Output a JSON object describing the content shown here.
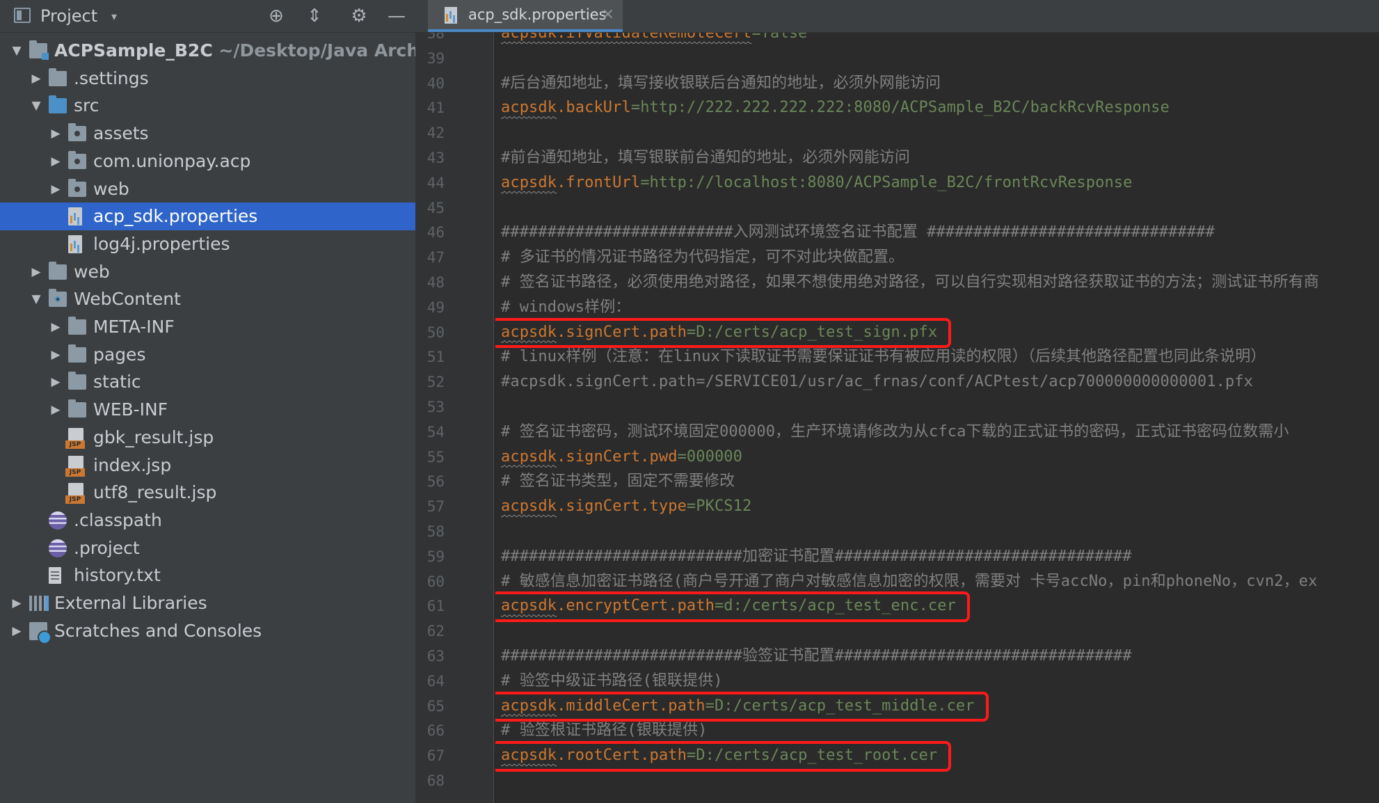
{
  "project_panel": {
    "title": "Project",
    "dropdown_glyph": "▾",
    "tools": [
      "crosshair-icon",
      "collapse-icon",
      "gear-icon",
      "minimize-icon"
    ],
    "tree": [
      {
        "label": "ACPSample_B2C",
        "hint": "~/Desktop/Java Archi",
        "icon": "module-icon",
        "arrow": "▼",
        "depth": 0,
        "bold": true
      },
      {
        "label": ".settings",
        "icon": "folder-icon",
        "arrow": "▶",
        "depth": 1
      },
      {
        "label": "src",
        "icon": "source-folder-icon",
        "arrow": "▼",
        "depth": 1
      },
      {
        "label": "assets",
        "icon": "package-icon",
        "arrow": "▶",
        "depth": 2
      },
      {
        "label": "com.unionpay.acp",
        "icon": "package-icon",
        "arrow": "▶",
        "depth": 2
      },
      {
        "label": "web",
        "icon": "package-icon",
        "arrow": "▶",
        "depth": 2
      },
      {
        "label": "acp_sdk.properties",
        "icon": "properties-file-icon",
        "arrow": "",
        "depth": 2,
        "selected": true
      },
      {
        "label": "log4j.properties",
        "icon": "properties-file-icon",
        "arrow": "",
        "depth": 2
      },
      {
        "label": "web",
        "icon": "folder-icon",
        "arrow": "▶",
        "depth": 1
      },
      {
        "label": "WebContent",
        "icon": "web-folder-icon",
        "arrow": "▼",
        "depth": 1
      },
      {
        "label": "META-INF",
        "icon": "folder-icon",
        "arrow": "▶",
        "depth": 2
      },
      {
        "label": "pages",
        "icon": "folder-icon",
        "arrow": "▶",
        "depth": 2
      },
      {
        "label": "static",
        "icon": "folder-icon",
        "arrow": "▶",
        "depth": 2
      },
      {
        "label": "WEB-INF",
        "icon": "folder-icon",
        "arrow": "▶",
        "depth": 2
      },
      {
        "label": "gbk_result.jsp",
        "icon": "jsp-file-icon",
        "arrow": "",
        "depth": 2
      },
      {
        "label": "index.jsp",
        "icon": "jsp-file-icon",
        "arrow": "",
        "depth": 2
      },
      {
        "label": "utf8_result.jsp",
        "icon": "jsp-file-icon",
        "arrow": "",
        "depth": 2
      },
      {
        "label": ".classpath",
        "icon": "eclipse-file-icon",
        "arrow": "",
        "depth": 1
      },
      {
        "label": ".project",
        "icon": "eclipse-file-icon",
        "arrow": "",
        "depth": 1
      },
      {
        "label": "history.txt",
        "icon": "text-file-icon",
        "arrow": "",
        "depth": 1
      },
      {
        "label": "External Libraries",
        "icon": "libraries-icon",
        "arrow": "▶",
        "depth": 0
      },
      {
        "label": "Scratches and Consoles",
        "icon": "scratches-icon",
        "arrow": "▶",
        "depth": 0
      }
    ]
  },
  "editor": {
    "tab": {
      "label": "acp_sdk.properties",
      "close": "×"
    },
    "lines": [
      {
        "n": "38",
        "parts": [
          {
            "t": "acpsdk.ifValidateRemoteCert",
            "s": "k"
          },
          {
            "t": "=false",
            "s": "v"
          }
        ]
      },
      {
        "n": "39",
        "parts": []
      },
      {
        "n": "40",
        "parts": [
          {
            "t": "#后台通知地址，填写接收银联后台通知的地址，必须外网能访问",
            "s": "c"
          }
        ]
      },
      {
        "n": "41",
        "parts": [
          {
            "t": "acpsdk",
            "s": "k"
          },
          {
            "t": ".backUrl",
            "s": "k2"
          },
          {
            "t": "=http://222.222.222.222:8080/ACPSample_B2C/backRcvResponse",
            "s": "v"
          }
        ]
      },
      {
        "n": "42",
        "parts": []
      },
      {
        "n": "43",
        "parts": [
          {
            "t": "#前台通知地址，填写银联前台通知的地址，必须外网能访问",
            "s": "c"
          }
        ]
      },
      {
        "n": "44",
        "parts": [
          {
            "t": "acpsdk",
            "s": "k"
          },
          {
            "t": ".frontUrl",
            "s": "k2"
          },
          {
            "t": "=http://localhost:8080/ACPSample_B2C/frontRcvResponse",
            "s": "v"
          }
        ]
      },
      {
        "n": "45",
        "parts": []
      },
      {
        "n": "46",
        "parts": [
          {
            "t": "#########################入网测试环境签名证书配置 ###############################",
            "s": "c"
          }
        ]
      },
      {
        "n": "47",
        "parts": [
          {
            "t": "# 多证书的情况证书路径为代码指定，可不对此块做配置。",
            "s": "c"
          }
        ]
      },
      {
        "n": "48",
        "parts": [
          {
            "t": "# 签名证书路径，必须使用绝对路径，如果不想使用绝对路径，可以自行实现相对路径获取证书的方法；测试证书所有商",
            "s": "c"
          }
        ]
      },
      {
        "n": "49",
        "parts": [
          {
            "t": "# windows样例：",
            "s": "c"
          }
        ]
      },
      {
        "n": "50",
        "parts": [
          {
            "t": "acpsdk",
            "s": "k"
          },
          {
            "t": ".signCert.path",
            "s": "k2"
          },
          {
            "t": "=D:/certs/acp_test_sign.pfx",
            "s": "v"
          }
        ]
      },
      {
        "n": "51",
        "parts": [
          {
            "t": "# linux样例（注意：在linux下读取证书需要保证证书有被应用读的权限）（后续其他路径配置也同此条说明）",
            "s": "c"
          }
        ]
      },
      {
        "n": "52",
        "parts": [
          {
            "t": "#acpsdk.signCert.path=/SERVICE01/usr/ac_frnas/conf/ACPtest/acp700000000000001.pfx",
            "s": "c"
          }
        ]
      },
      {
        "n": "53",
        "parts": []
      },
      {
        "n": "54",
        "parts": [
          {
            "t": "# 签名证书密码，测试环境固定000000，生产环境请修改为从cfca下载的正式证书的密码，正式证书密码位数需小",
            "s": "c"
          }
        ]
      },
      {
        "n": "55",
        "parts": [
          {
            "t": "acpsdk",
            "s": "k"
          },
          {
            "t": ".signCert.pwd",
            "s": "k2"
          },
          {
            "t": "=000000",
            "s": "v"
          }
        ]
      },
      {
        "n": "56",
        "parts": [
          {
            "t": "# 签名证书类型，固定不需要修改",
            "s": "c"
          }
        ]
      },
      {
        "n": "57",
        "parts": [
          {
            "t": "acpsdk",
            "s": "k"
          },
          {
            "t": ".signCert.type",
            "s": "k2"
          },
          {
            "t": "=PKCS12",
            "s": "v"
          }
        ]
      },
      {
        "n": "58",
        "parts": []
      },
      {
        "n": "59",
        "parts": [
          {
            "t": "##########################加密证书配置################################",
            "s": "c"
          }
        ]
      },
      {
        "n": "60",
        "parts": [
          {
            "t": "# 敏感信息加密证书路径(商户号开通了商户对敏感信息加密的权限，需要对 卡号accNo，pin和phoneNo，cvn2，ex",
            "s": "c"
          }
        ]
      },
      {
        "n": "61",
        "parts": [
          {
            "t": "acpsdk",
            "s": "k"
          },
          {
            "t": ".encryptCert.path",
            "s": "k2"
          },
          {
            "t": "=d:/certs/acp_test_enc.cer",
            "s": "v"
          }
        ]
      },
      {
        "n": "62",
        "parts": []
      },
      {
        "n": "63",
        "parts": [
          {
            "t": "##########################验签证书配置################################",
            "s": "c"
          }
        ]
      },
      {
        "n": "64",
        "parts": [
          {
            "t": "# 验签中级证书路径(银联提供)",
            "s": "c"
          }
        ]
      },
      {
        "n": "65",
        "parts": [
          {
            "t": "acpsdk",
            "s": "k"
          },
          {
            "t": ".middleCert.path",
            "s": "k2"
          },
          {
            "t": "=D:/certs/acp_test_middle.cer",
            "s": "v"
          }
        ]
      },
      {
        "n": "66",
        "parts": [
          {
            "t": "# 验签根证书路径(银联提供)",
            "s": "c"
          }
        ]
      },
      {
        "n": "67",
        "parts": [
          {
            "t": "acpsdk",
            "s": "k"
          },
          {
            "t": ".rootCert.path",
            "s": "k2"
          },
          {
            "t": "=D:/certs/acp_test_root.cer",
            "s": "v"
          }
        ]
      },
      {
        "n": "68",
        "parts": []
      }
    ],
    "highlighted_lines": [
      "50",
      "61",
      "65",
      "67"
    ],
    "colors": {
      "key": "#cc7832",
      "value": "#6a8759",
      "comment": "#808080",
      "highlight": "#ff1a1a",
      "selection": "#2f65ca"
    }
  }
}
